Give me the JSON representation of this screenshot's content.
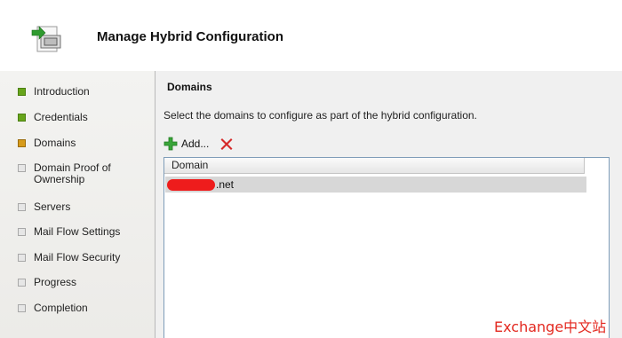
{
  "header": {
    "title": "Manage Hybrid Configuration",
    "icon": "wizard-hybrid-config-icon"
  },
  "steps": [
    {
      "label": "Introduction",
      "state": "completed"
    },
    {
      "label": "Credentials",
      "state": "completed"
    },
    {
      "label": "Domains",
      "state": "current"
    },
    {
      "label": "Domain Proof of Ownership",
      "state": "pending"
    },
    {
      "label": "Servers",
      "state": "pending"
    },
    {
      "label": "Mail Flow Settings",
      "state": "pending"
    },
    {
      "label": "Mail Flow Security",
      "state": "pending"
    },
    {
      "label": "Progress",
      "state": "pending"
    },
    {
      "label": "Completion",
      "state": "pending"
    }
  ],
  "domains_page": {
    "title": "Domains",
    "description": "Select the domains to configure as part of the hybrid configuration.",
    "add_label": "Add...",
    "remove_icon": "red-x-icon",
    "column_header": "Domain",
    "rows": [
      {
        "domain_suffix": ".net",
        "redacted": true
      }
    ]
  },
  "watermark": "Exchange中文站",
  "colors": {
    "completed": "#67a51b",
    "current": "#d79b1a",
    "pending": "#e6e6e6",
    "selected_row": "#d7d7d7",
    "redaction": "#ee1c1c",
    "watermark": "#e3281f"
  }
}
